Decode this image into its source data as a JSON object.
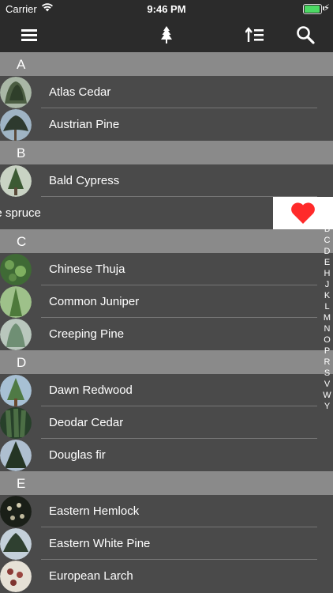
{
  "status": {
    "carrier": "Carrier",
    "time": "9:46 PM"
  },
  "nav": {
    "icons": [
      "menu-icon",
      "tree-icon",
      "sort-icon",
      "search-icon"
    ]
  },
  "sections": [
    {
      "letter": "A",
      "rows": [
        "Atlas Cedar",
        "Austrian Pine"
      ]
    },
    {
      "letter": "B",
      "rows": [
        "Bald Cypress",
        "ue spruce"
      ]
    },
    {
      "letter": "C",
      "rows": [
        "Chinese Thuja",
        "Common Juniper",
        "Creeping Pine"
      ]
    },
    {
      "letter": "D",
      "rows": [
        "Dawn Redwood",
        "Deodar Cedar",
        "Douglas fir"
      ]
    },
    {
      "letter": "E",
      "rows": [
        "Eastern Hemlock",
        "Eastern White Pine",
        "European Larch"
      ]
    }
  ],
  "favorite_action": {
    "icon": "heart-icon",
    "color": "#ff2a2a"
  },
  "index": [
    "B",
    "C",
    "D",
    "E",
    "H",
    "J",
    "K",
    "L",
    "M",
    "N",
    "O",
    "P",
    "R",
    "S",
    "V",
    "W",
    "Y"
  ]
}
